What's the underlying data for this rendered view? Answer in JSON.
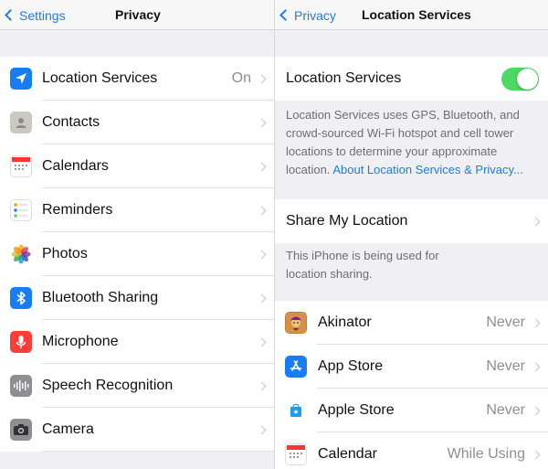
{
  "left": {
    "back_label": "Settings",
    "title": "Privacy",
    "items": [
      {
        "label": "Location Services",
        "value": "On",
        "icon": "location-arrow-icon"
      },
      {
        "label": "Contacts",
        "icon": "contacts-icon"
      },
      {
        "label": "Calendars",
        "icon": "calendar-icon"
      },
      {
        "label": "Reminders",
        "icon": "reminders-icon"
      },
      {
        "label": "Photos",
        "icon": "photos-icon"
      },
      {
        "label": "Bluetooth Sharing",
        "icon": "bluetooth-icon"
      },
      {
        "label": "Microphone",
        "icon": "microphone-icon"
      },
      {
        "label": "Speech Recognition",
        "icon": "waveform-icon"
      },
      {
        "label": "Camera",
        "icon": "camera-icon"
      }
    ]
  },
  "right": {
    "back_label": "Privacy",
    "title": "Location Services",
    "toggle_label": "Location Services",
    "toggle_on": true,
    "description": "Location Services uses GPS, Bluetooth, and crowd-sourced Wi-Fi hotspot and cell tower locations to determine your approximate location.",
    "description_link": "About Location Services & Privacy...",
    "share_label": "Share My Location",
    "share_note": "This iPhone is being used for location sharing.",
    "apps": [
      {
        "label": "Akinator",
        "value": "Never",
        "icon": "akinator-genie-icon"
      },
      {
        "label": "App Store",
        "value": "Never",
        "icon": "app-store-icon"
      },
      {
        "label": "Apple Store",
        "value": "Never",
        "icon": "apple-store-bag-icon"
      },
      {
        "label": "Calendar",
        "value": "While Using",
        "icon": "calendar-icon"
      }
    ]
  },
  "colors": {
    "accent": "#1a7cf5",
    "toggle_on": "#4cd964",
    "background": "#efeff4"
  }
}
